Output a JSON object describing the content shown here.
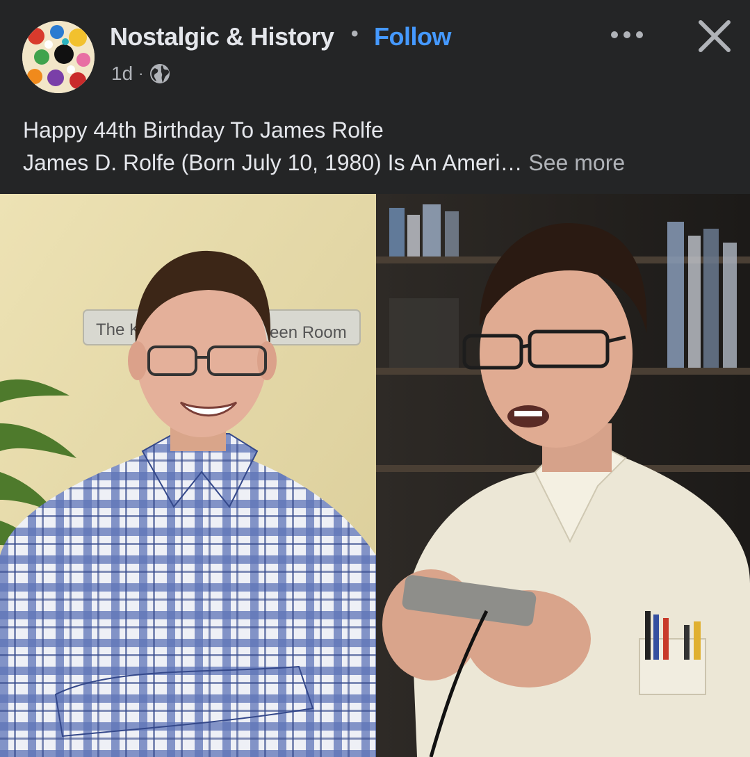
{
  "post": {
    "page_name": "Nostalgic & History",
    "separator": "•",
    "follow_label": "Follow",
    "time": "1d",
    "time_separator": "·",
    "privacy_icon": "globe-icon",
    "caption_line1": "Happy 44th Birthday To James Rolfe",
    "caption_line2": "James D. Rolfe (Born July 10, 1980) Is An Ameri…",
    "see_more_label": "See more"
  },
  "photo": {
    "left_sign_text_a": "The K",
    "left_sign_text_b": "een Room"
  },
  "colors": {
    "background": "#242526",
    "text_primary": "#e4e6eb",
    "text_secondary": "#b0b3b8",
    "link": "#4599ff"
  }
}
